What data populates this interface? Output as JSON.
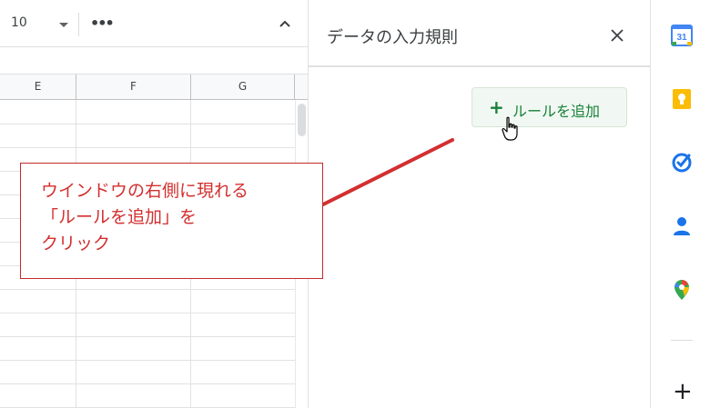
{
  "toolbar": {
    "font_size": "10",
    "more_label": "•••"
  },
  "grid": {
    "columns": [
      "E",
      "F",
      "G"
    ]
  },
  "side_panel": {
    "title": "データの入力規則",
    "add_rule_label": "ルールを追加"
  },
  "callout": {
    "lines": [
      "ウインドウの右側に現れる",
      "「ルールを追加」を",
      "クリック"
    ]
  },
  "colors": {
    "accent_green": "#188038",
    "annotation_red": "#d32f2f"
  },
  "rail": {
    "icons": [
      "calendar-icon",
      "keep-icon",
      "tasks-icon",
      "contacts-icon",
      "maps-icon"
    ],
    "calendar_day": "31",
    "add_label": "+"
  }
}
